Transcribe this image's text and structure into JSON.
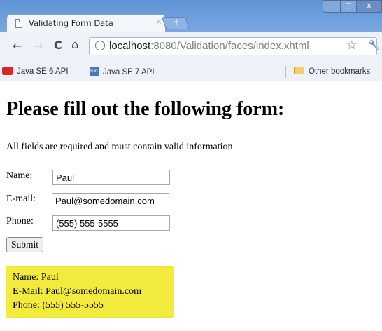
{
  "browser": {
    "tab_title": "Validating Form Data",
    "tab_close": "×",
    "new_tab": "+",
    "url_host": "localhost",
    "url_rest": ":8080/Validation/faces/index.xhtml",
    "window_controls": {
      "minimize": "–",
      "maximize": "□",
      "close": "x"
    }
  },
  "bookmarks": {
    "items": [
      {
        "label": "Java SE 6 API",
        "icon": "java-icon"
      },
      {
        "label": "Java SE 7 API",
        "icon": "sun-icon"
      }
    ],
    "other": {
      "label": "Other bookmarks",
      "icon": "folder-icon"
    }
  },
  "page": {
    "heading": "Please fill out the following form:",
    "instructions": "All fields are required and must contain valid information",
    "fields": [
      {
        "label": "Name:",
        "value": "Paul"
      },
      {
        "label": "E-mail:",
        "value": "Paul@somedomain.com"
      },
      {
        "label": "Phone:",
        "value": "(555) 555-5555"
      }
    ],
    "submit_label": "Submit",
    "result": {
      "name_line": "Name: Paul",
      "email_line": "E-Mail: Paul@somedomain.com",
      "phone_line": "Phone: (555) 555-5555",
      "background": "#f2ea3d"
    }
  },
  "colors": {
    "titlebar": "#6a9bd8",
    "toolbar": "#eef2f8"
  }
}
